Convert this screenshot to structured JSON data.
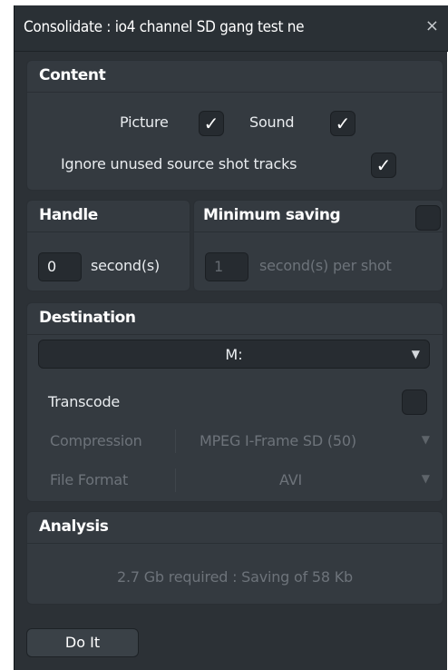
{
  "window": {
    "title": "Consolidate : io4 channel SD gang test ne",
    "close_glyph": "×"
  },
  "content": {
    "title": "Content",
    "picture_label": "Picture",
    "picture_checked": true,
    "sound_label": "Sound",
    "sound_checked": true,
    "ignore_label": "Ignore unused source shot tracks",
    "ignore_checked": true,
    "check_glyph": "✓"
  },
  "handle": {
    "title": "Handle",
    "value": "0",
    "unit": "second(s)"
  },
  "minimum_saving": {
    "title": "Minimum saving",
    "checked": false,
    "value": "1",
    "unit": "second(s) per shot"
  },
  "destination": {
    "title": "Destination",
    "drive_value": "M:",
    "transcode_label": "Transcode",
    "transcode_checked": false,
    "compression_label": "Compression",
    "compression_value": "MPEG I-Frame SD (50)",
    "file_format_label": "File Format",
    "file_format_value": "AVI",
    "caret_glyph": "▼"
  },
  "analysis": {
    "title": "Analysis",
    "summary": "2.7 Gb required : Saving of 58 Kb"
  },
  "actions": {
    "do_it_label": "Do It"
  }
}
